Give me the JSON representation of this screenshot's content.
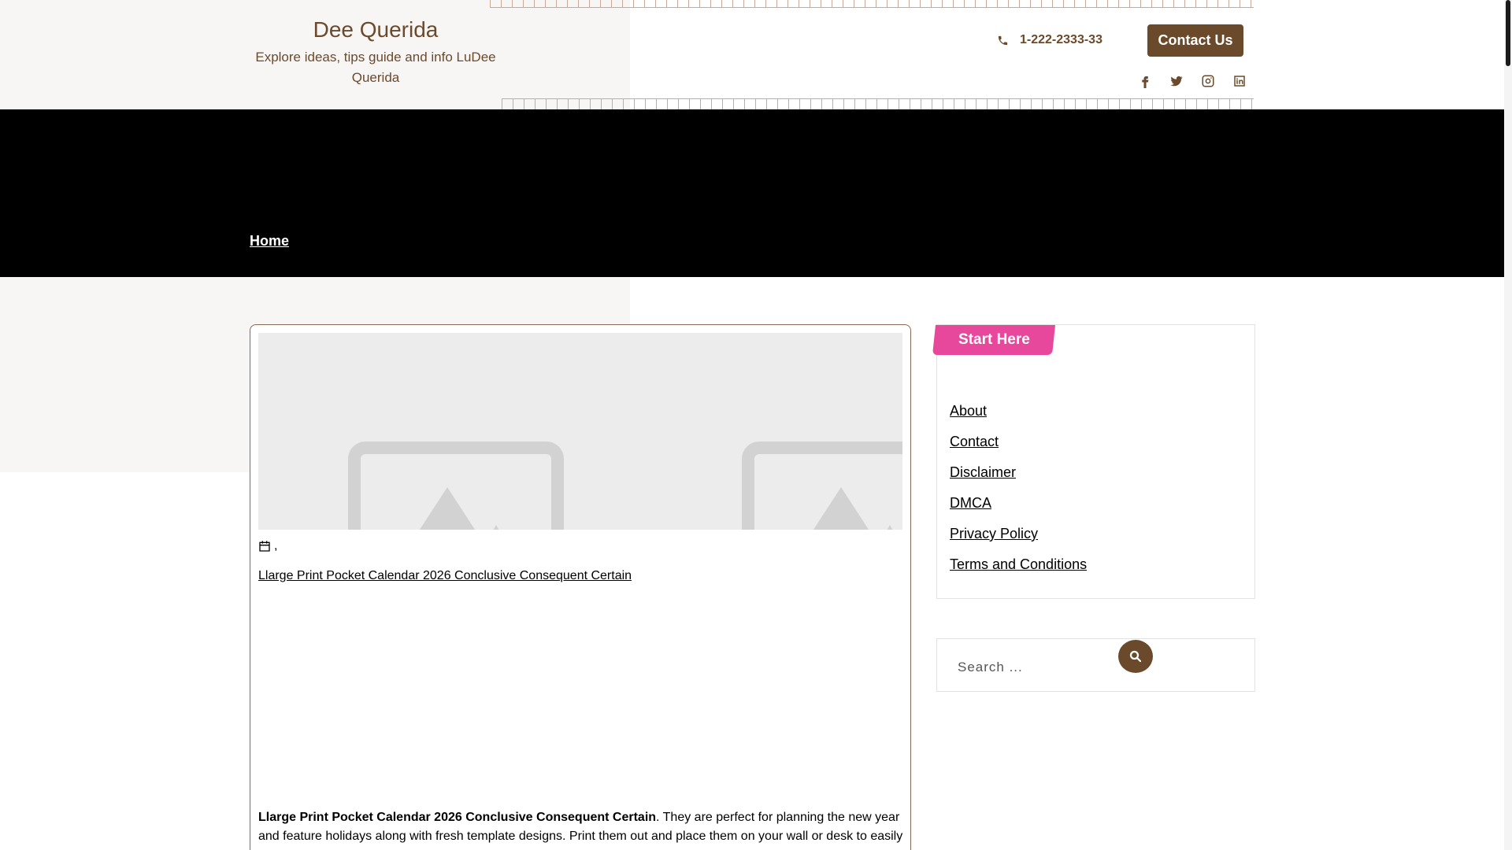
{
  "site": {
    "title": "Dee Querida",
    "tagline": "Explore ideas, tips guide and info LuDee Querida"
  },
  "header": {
    "phone": "1-222-2333-33",
    "contact_button": "Contact Us",
    "socials": [
      "facebook-icon",
      "twitter-icon",
      "instagram-icon",
      "linkedin-icon"
    ]
  },
  "nav": {
    "home": "Home"
  },
  "post": {
    "meta_separator": ",",
    "title_link": "Llarge Print Pocket Calendar 2026 Conclusive Consequent Certain",
    "excerpt_bold": "Llarge Print Pocket Calendar 2026 Conclusive Consequent Certain",
    "excerpt_rest": ". They are perfect for planning the new year and feature holidays along with fresh template designs. Print them out and place them on your wall or desk to easily"
  },
  "sidebar": {
    "widget_title": "Start Here",
    "links": [
      "About",
      "Contact",
      "Disclaimer",
      "DMCA",
      "Privacy Policy",
      "Terms and Conditions"
    ],
    "search_placeholder": "Search ..."
  },
  "colors": {
    "brand": "#6b4a2c",
    "accent": "#e8489b",
    "nav_bg": "#000000"
  }
}
